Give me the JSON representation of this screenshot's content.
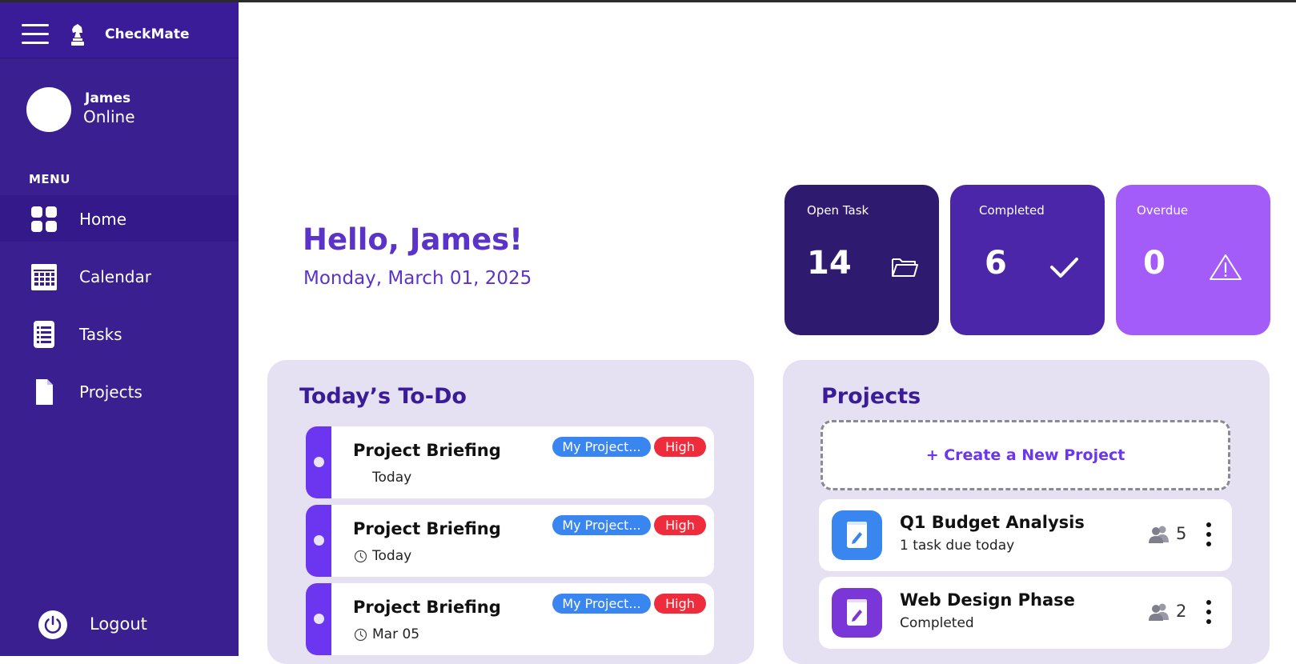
{
  "app": {
    "name": "CheckMate"
  },
  "user": {
    "name": "James",
    "status": "Online"
  },
  "sidebar": {
    "menu_heading": "MENU",
    "items": [
      {
        "label": "Home",
        "icon": "grid-icon",
        "active": true
      },
      {
        "label": "Calendar",
        "icon": "calendar-icon",
        "active": false
      },
      {
        "label": "Tasks",
        "icon": "tasks-icon",
        "active": false
      },
      {
        "label": "Projects",
        "icon": "file-icon",
        "active": false
      }
    ],
    "logout_label": "Logout"
  },
  "header": {
    "greeting": "Hello, James!",
    "date": "Monday, March 01, 2025"
  },
  "stats": [
    {
      "label": "Open Task",
      "value": "14",
      "icon": "folder-icon",
      "color": "#2e1a6e"
    },
    {
      "label": "Completed",
      "value": "6",
      "icon": "check-icon",
      "color": "#4b26a8"
    },
    {
      "label": "Overdue",
      "value": "0",
      "icon": "warning-icon",
      "color": "#a45cf8"
    }
  ],
  "todo": {
    "title": "Today’s To-Do",
    "items": [
      {
        "title": "Project Briefing",
        "date": "Today",
        "project": "My Project...",
        "priority": "High"
      },
      {
        "title": "Project Briefing",
        "date": "Today",
        "project": "My Project...",
        "priority": "High"
      },
      {
        "title": "Project Briefing",
        "date": "Mar 05",
        "project": "My Project...",
        "priority": "High"
      }
    ]
  },
  "projects": {
    "title": "Projects",
    "create_label": "+ Create a New Project",
    "items": [
      {
        "name": "Q1 Budget Analysis",
        "subtitle": "1 task due today",
        "members": "5",
        "color": "#3a86f0"
      },
      {
        "name": "Web Design Phase",
        "subtitle": "Completed",
        "members": "2",
        "color": "#7a36d6"
      }
    ]
  }
}
